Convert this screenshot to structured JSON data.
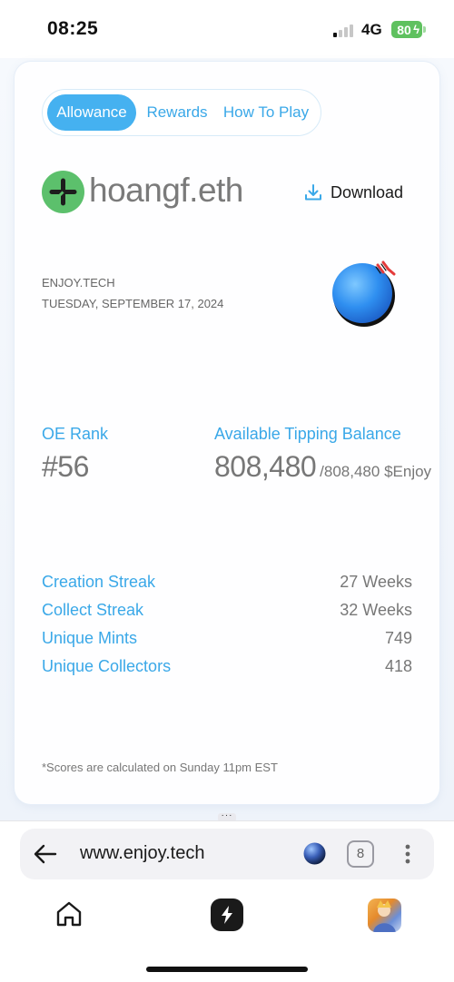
{
  "status_bar": {
    "time": "08:25",
    "network": "4G",
    "battery": "80"
  },
  "tabs": [
    {
      "label": "Allowance",
      "active": true
    },
    {
      "label": "Rewards",
      "active": false
    },
    {
      "label": "How To Play",
      "active": false
    }
  ],
  "profile": {
    "username": "hoangf.eth",
    "logo_icon": "plus-logo-icon",
    "logo_color": "#5cc06c"
  },
  "download": {
    "label": "Download",
    "icon": "download-icon"
  },
  "meta": {
    "brand": "ENJOY.TECH",
    "date": "TUESDAY, SEPTEMBER 17, 2024"
  },
  "rank": {
    "label": "OE Rank",
    "value": "#56"
  },
  "balance": {
    "label": "Available Tipping Balance",
    "value": "808,480",
    "total": "/808,480 $Enjoy"
  },
  "stats": [
    {
      "label": "Creation Streak",
      "value": "27 Weeks"
    },
    {
      "label": "Collect Streak",
      "value": "32 Weeks"
    },
    {
      "label": "Unique Mints",
      "value": "749"
    },
    {
      "label": "Unique Collectors",
      "value": "418"
    }
  ],
  "footnote": "*Scores are calculated on Sunday 11pm EST",
  "browser": {
    "url": "www.enjoy.tech",
    "tab_count": "8"
  },
  "colors": {
    "accent": "#3aa8e8",
    "active_tab": "#45b1f0",
    "battery": "#5fc15f"
  }
}
